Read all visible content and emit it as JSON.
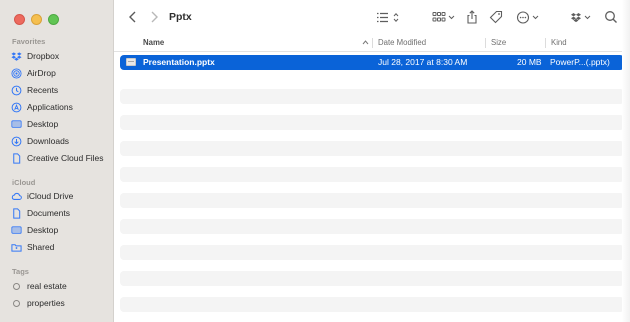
{
  "window": {
    "title": "Pptx"
  },
  "sidebar": {
    "favorites_label": "Favorites",
    "favorites": [
      {
        "label": "Dropbox",
        "icon": "dropbox-icon"
      },
      {
        "label": "AirDrop",
        "icon": "airdrop-icon"
      },
      {
        "label": "Recents",
        "icon": "clock-icon"
      },
      {
        "label": "Applications",
        "icon": "applications-icon"
      },
      {
        "label": "Desktop",
        "icon": "desktop-icon"
      },
      {
        "label": "Downloads",
        "icon": "download-icon"
      },
      {
        "label": "Creative Cloud Files",
        "icon": "document-icon"
      }
    ],
    "icloud_label": "iCloud",
    "icloud": [
      {
        "label": "iCloud Drive",
        "icon": "cloud-icon"
      },
      {
        "label": "Documents",
        "icon": "document-icon"
      },
      {
        "label": "Desktop",
        "icon": "desktop-icon"
      },
      {
        "label": "Shared",
        "icon": "shared-folder-icon"
      }
    ],
    "tags_label": "Tags",
    "tags": [
      {
        "label": "real estate"
      },
      {
        "label": "properties"
      }
    ]
  },
  "columns": {
    "name": "Name",
    "date_modified": "Date Modified",
    "size": "Size",
    "kind": "Kind"
  },
  "files": [
    {
      "name": "Presentation.pptx",
      "date_modified": "Jul 28, 2017 at 8:30 AM",
      "size": "20 MB",
      "kind": "PowerP...(.pptx)",
      "selected": true
    }
  ],
  "colors": {
    "selection": "#0a63d8",
    "sidebar_bg": "#e6e3df",
    "accent_icon": "#3478f6"
  }
}
